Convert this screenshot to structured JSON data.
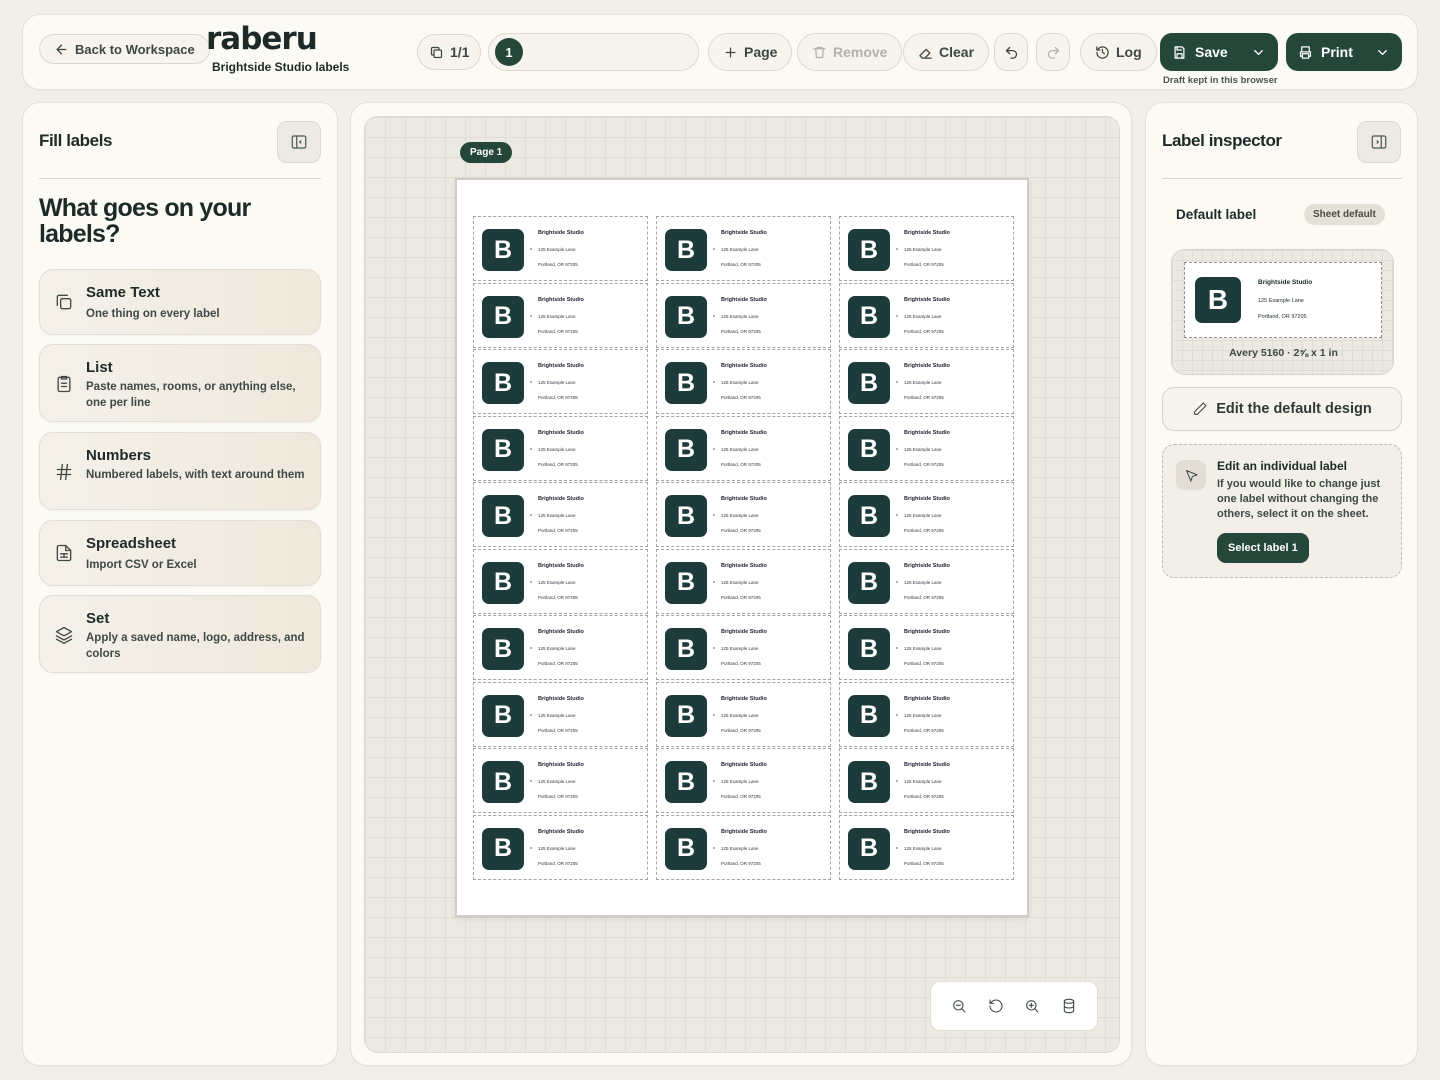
{
  "topbar": {
    "back_label": "Back to Workspace",
    "app_name": "raberu",
    "doc_title": "Brightside Studio labels",
    "page_counter": "1/1",
    "current_page": "1",
    "add_page_label": "Page",
    "remove_label": "Remove",
    "clear_label": "Clear",
    "log_label": "Log",
    "save_label": "Save",
    "print_label": "Print",
    "draft_note": "Draft kept in this browser"
  },
  "left": {
    "title": "Fill labels",
    "question": "What goes on your labels?",
    "options": [
      {
        "title": "Same Text",
        "desc": "One thing on every label",
        "icon": "copy-icon"
      },
      {
        "title": "List",
        "desc": "Paste names, rooms, or anything else, one per line",
        "icon": "clipboard-list-icon"
      },
      {
        "title": "Numbers",
        "desc": "Numbered labels, with text around them",
        "icon": "hash-icon"
      },
      {
        "title": "Spreadsheet",
        "desc": "Import CSV or Excel",
        "icon": "spreadsheet-icon"
      },
      {
        "title": "Set",
        "desc": "Apply a saved name, logo, address, and colors",
        "icon": "layers-icon"
      }
    ]
  },
  "canvas": {
    "page_badge": "Page 1",
    "rows": 10,
    "cols": 3,
    "label": {
      "logo_letter": "B",
      "line1": "Brightside Studio",
      "line2": "125 Example Lane",
      "line3": "Portland, OR 97205"
    }
  },
  "right": {
    "title": "Label inspector",
    "section": "Default label",
    "chip": "Sheet default",
    "preview_caption": "Avery 5160 · 2⅝ x 1 in",
    "edit_default": "Edit the default design",
    "individual_title": "Edit an individual label",
    "individual_desc": "If you would like to change just one label without changing the others, select it on the sheet.",
    "select_label": "Select label 1"
  },
  "colors": {
    "accent": "#24473a",
    "logo_bg": "#1d3b3b",
    "background": "#f1efe8"
  }
}
